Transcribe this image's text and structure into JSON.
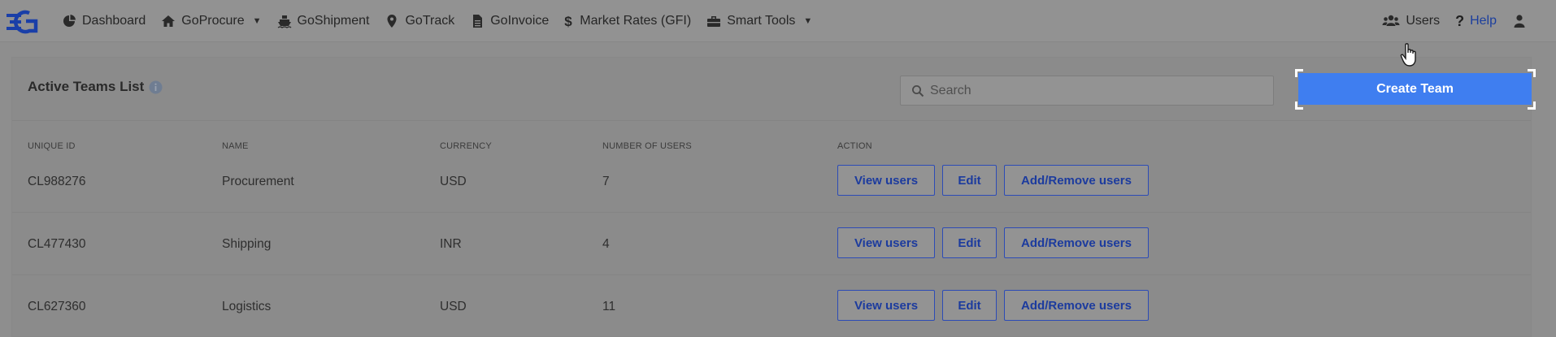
{
  "nav": {
    "items": [
      {
        "label": "Dashboard",
        "icon": "dashboard-icon"
      },
      {
        "label": "GoProcure",
        "icon": "home-icon",
        "dropdown": true
      },
      {
        "label": "GoShipment",
        "icon": "ship-icon"
      },
      {
        "label": "GoTrack",
        "icon": "map-pin-icon"
      },
      {
        "label": "GoInvoice",
        "icon": "document-icon"
      },
      {
        "label": "Market Rates (GFI)",
        "icon": "dollar-icon"
      },
      {
        "label": "Smart Tools",
        "icon": "toolbox-icon",
        "dropdown": true
      }
    ],
    "right": {
      "users_label": "Users",
      "help_label": "Help",
      "help_icon": "?",
      "caret": "▼"
    }
  },
  "panel": {
    "title": "Active Teams List",
    "search_placeholder": "Search",
    "create_label": "Create Team"
  },
  "table": {
    "headers": [
      "UNIQUE ID",
      "NAME",
      "CURRENCY",
      "NUMBER OF USERS",
      "ACTION"
    ],
    "rows": [
      {
        "id": "CL988276",
        "name": "Procurement",
        "currency": "USD",
        "users": "7"
      },
      {
        "id": "CL477430",
        "name": "Shipping",
        "currency": "INR",
        "users": "4"
      },
      {
        "id": "CL627360",
        "name": "Logistics",
        "currency": "USD",
        "users": "11"
      }
    ],
    "actions": {
      "view": "View users",
      "edit": "Edit",
      "addremove": "Add/Remove users"
    }
  },
  "colors": {
    "accent": "#3f7ef0",
    "overlay": "#8e8e8e",
    "link": "#1c3f9e"
  }
}
